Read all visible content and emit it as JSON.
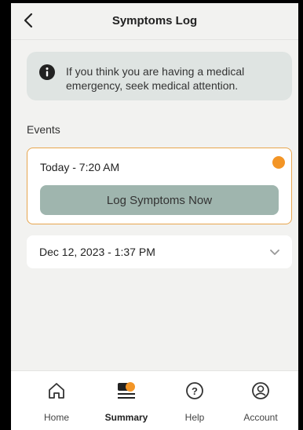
{
  "header": {
    "title": "Symptoms Log"
  },
  "banner": {
    "message": "If you think you are having a medical emergency, seek medical attention."
  },
  "events": {
    "label": "Events",
    "active": {
      "time": "Today - 7:20 AM",
      "button_label": "Log Symptoms Now"
    },
    "past": [
      {
        "time": "Dec 12, 2023 - 1:37 PM"
      }
    ]
  },
  "tabs": [
    {
      "label": "Home",
      "icon": "home-icon",
      "active": false
    },
    {
      "label": "Summary",
      "icon": "summary-icon",
      "active": true
    },
    {
      "label": "Help",
      "icon": "help-icon",
      "active": false
    },
    {
      "label": "Account",
      "icon": "account-icon",
      "active": false
    }
  ],
  "colors": {
    "accent": "#f39526",
    "border_active": "#e7a54d",
    "button_bg": "#9fb5ae"
  }
}
